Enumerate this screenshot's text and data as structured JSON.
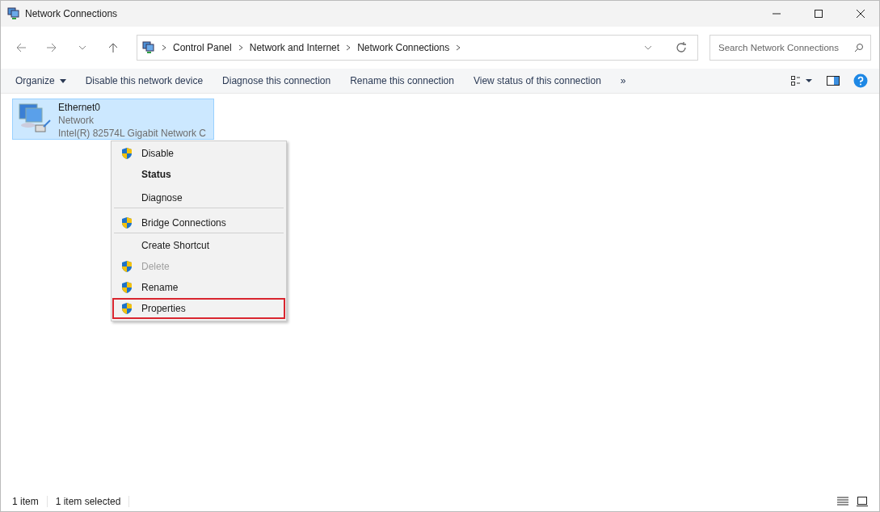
{
  "window": {
    "title": "Network Connections"
  },
  "address": {
    "crumbs": [
      "Control Panel",
      "Network and Internet",
      "Network Connections"
    ]
  },
  "search": {
    "placeholder": "Search Network Connections"
  },
  "commands": [
    {
      "label": "Organize",
      "dropdown": true
    },
    {
      "label": "Disable this network device",
      "dropdown": false
    },
    {
      "label": "Diagnose this connection",
      "dropdown": false
    },
    {
      "label": "Rename this connection",
      "dropdown": false
    },
    {
      "label": "View status of this connection",
      "dropdown": false
    },
    {
      "label": "»",
      "dropdown": false
    }
  ],
  "connections": [
    {
      "name": "Ethernet0",
      "status": "Network",
      "device": "Intel(R) 82574L Gigabit Network C",
      "selected": true
    }
  ],
  "context_menu": [
    {
      "label": "Disable",
      "shield": true,
      "default": false,
      "disabled": false,
      "highlighted": false,
      "separator_after": false
    },
    {
      "label": "Status",
      "shield": false,
      "default": true,
      "disabled": false,
      "highlighted": false,
      "separator_after": false
    },
    {
      "label": "Diagnose",
      "shield": false,
      "default": false,
      "disabled": false,
      "highlighted": false,
      "separator_after": true
    },
    {
      "label": "Bridge Connections",
      "shield": true,
      "default": false,
      "disabled": false,
      "highlighted": false,
      "separator_after": true
    },
    {
      "label": "Create Shortcut",
      "shield": false,
      "default": false,
      "disabled": false,
      "highlighted": false,
      "separator_after": false
    },
    {
      "label": "Delete",
      "shield": true,
      "default": false,
      "disabled": true,
      "highlighted": false,
      "separator_after": false
    },
    {
      "label": "Rename",
      "shield": true,
      "default": false,
      "disabled": false,
      "highlighted": false,
      "separator_after": false
    },
    {
      "label": "Properties",
      "shield": true,
      "default": false,
      "disabled": false,
      "highlighted": true,
      "separator_after": false
    }
  ],
  "status_bar": {
    "count": "1 item",
    "selection": "1 item selected"
  }
}
